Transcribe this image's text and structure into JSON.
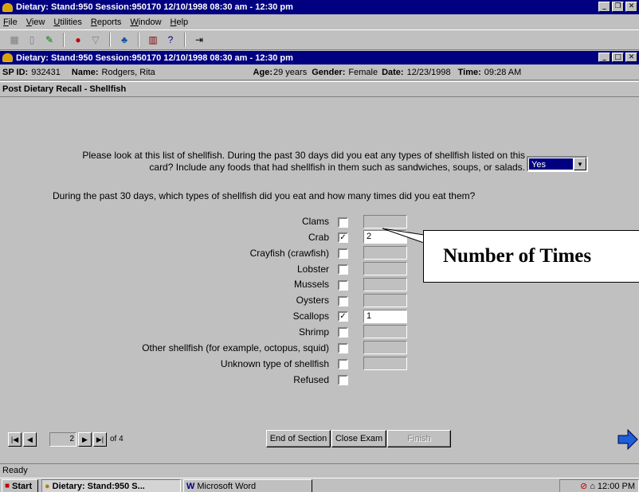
{
  "app": {
    "title": "Dietary: Stand:950 Session:950170 12/10/1998 08:30 am - 12:30 pm",
    "menu": [
      "File",
      "View",
      "Utilities",
      "Reports",
      "Window",
      "Help"
    ]
  },
  "mdi": {
    "title": "Dietary: Stand:950 Session:950170 12/10/1998 08:30 am - 12:30 pm"
  },
  "info": {
    "sp_id_label": "SP ID:",
    "sp_id": "932431",
    "name_label": "Name:",
    "name": "Rodgers, Rita",
    "age_label": "Age:",
    "age": "29 years",
    "gender_label": "Gender:",
    "gender": "Female",
    "date_label": "Date:",
    "date": "12/23/1998",
    "time_label": "Time:",
    "time": "09:28 AM"
  },
  "section": {
    "title": "Post Dietary Recall - Shellfish"
  },
  "question1": {
    "line1": "Please look at this list of shellfish. During the past 30 days did you eat any types of shellfish listed on this",
    "line2": "card? Include any foods that had shellfish in them such as sandwiches, soups, or salads.",
    "answer": "Yes"
  },
  "question2": {
    "text": "During the past 30 days, which types of shellfish did you eat and how many times did you eat them?"
  },
  "items": [
    {
      "label": "Clams",
      "checked": false,
      "count": ""
    },
    {
      "label": "Crab",
      "checked": true,
      "count": "2"
    },
    {
      "label": "Crayfish (crawfish)",
      "checked": false,
      "count": ""
    },
    {
      "label": "Lobster",
      "checked": false,
      "count": ""
    },
    {
      "label": "Mussels",
      "checked": false,
      "count": ""
    },
    {
      "label": "Oysters",
      "checked": false,
      "count": ""
    },
    {
      "label": "Scallops",
      "checked": true,
      "count": "1"
    },
    {
      "label": "Shrimp",
      "checked": false,
      "count": ""
    },
    {
      "label": "Other shellfish (for example, octopus, squid)",
      "checked": false,
      "count": ""
    },
    {
      "label": "Unknown type of shellfish",
      "checked": false,
      "count": ""
    },
    {
      "label": "Refused",
      "checked": false,
      "count": null
    }
  ],
  "callout": "Number of Times",
  "nav": {
    "page": "2",
    "of_label": "of 4",
    "end_of_section": "End of Section",
    "close_exam": "Close Exam",
    "finish": "Finish"
  },
  "status": "Ready",
  "taskbar": {
    "start": "Start",
    "task1": "Dietary: Stand:950 S...",
    "task2": "Microsoft Word",
    "clock": "12:00 PM"
  },
  "colors": {
    "title_bg": "#000080",
    "window_bg": "#c0c0c0",
    "next_arrow": "#1c5fd6"
  }
}
